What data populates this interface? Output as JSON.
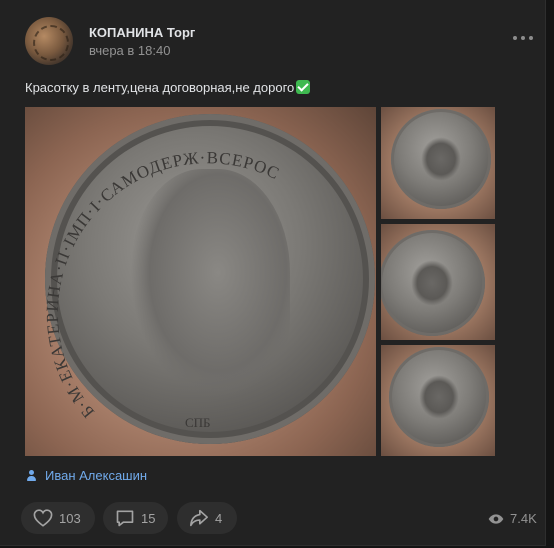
{
  "post": {
    "author": "КОПАНИНА Торг",
    "time": "вчера в 18:40",
    "text": "Красотку в ленту,цена договорная,не дорого",
    "signer": "Иван Алексашин"
  },
  "coin_legend": "Б·М·ЕКАТЕРИНА·II·IМП·I·САМОДЕРЖ·ВСЕРОС",
  "coin_mint": "СПБ",
  "actions": {
    "likes": "103",
    "comments": "15",
    "shares": "4",
    "views": "7.4K"
  },
  "icons": [
    "more-icon",
    "checkmark-emoji-icon",
    "person-icon",
    "heart-icon",
    "comment-icon",
    "share-icon",
    "eye-icon"
  ],
  "colors": {
    "background": "#141414",
    "card": "#222222",
    "link": "#71aaeb",
    "muted": "#939393",
    "check_emoji": "#3fb950"
  }
}
